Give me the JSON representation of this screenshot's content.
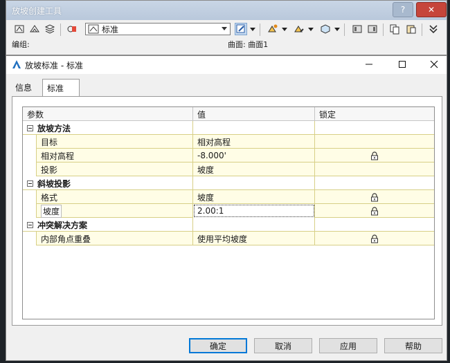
{
  "toolbar": {
    "title": "放坡创建工具",
    "help_button": "?",
    "close_button": "✕",
    "style_select_value": "标准",
    "group_label": "编组:",
    "surface_label": "曲面: 曲面1"
  },
  "dialog": {
    "title": "放坡标准 - 标准",
    "tabs": [
      "信息",
      "标准"
    ],
    "active_tab": "标准",
    "grid": {
      "headers": [
        "参数",
        "值",
        "锁定"
      ],
      "rows": [
        {
          "kind": "category",
          "name": "放坡方法",
          "value": ""
        },
        {
          "kind": "property",
          "name": "目标",
          "value": "相对高程",
          "locked": false
        },
        {
          "kind": "property",
          "name": "相对高程",
          "value": "-8.000'",
          "locked": true
        },
        {
          "kind": "property",
          "name": "投影",
          "value": "坡度",
          "locked": false
        },
        {
          "kind": "category",
          "name": "斜坡投影",
          "value": ""
        },
        {
          "kind": "property",
          "name": "格式",
          "value": "坡度",
          "locked": true
        },
        {
          "kind": "property",
          "name": "坡度",
          "value": "2.00:1",
          "locked": true,
          "selected": true
        },
        {
          "kind": "category",
          "name": "冲突解决方案",
          "value": ""
        },
        {
          "kind": "property",
          "name": "内部角点重叠",
          "value": "使用平均坡度",
          "locked": true
        }
      ]
    },
    "buttons": {
      "ok": "确定",
      "cancel": "取消",
      "apply": "应用",
      "help": "帮助"
    }
  },
  "colors": {
    "desktop": "#1e2328",
    "property_row": "#fffde6",
    "ok_border": "#0078d7",
    "close_red": "#c6453a"
  }
}
